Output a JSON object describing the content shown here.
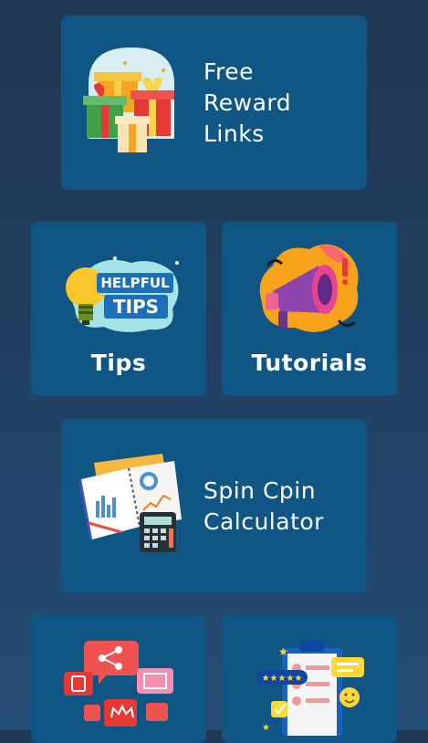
{
  "cards": {
    "free_reward": {
      "line1": "Free",
      "line2": "Reward",
      "line3": "Links",
      "icon": "gift-boxes-icon"
    },
    "tips": {
      "label": "Tips",
      "badge_line1": "HELPFUL",
      "badge_line2": "TIPS",
      "icon": "lightbulb-tips-icon"
    },
    "tutorials": {
      "label": "Tutorials",
      "icon": "megaphone-icon"
    },
    "spin_calculator": {
      "line1": "Spin Cpin",
      "line2": "Calculator",
      "icon": "notebook-calculator-icon"
    },
    "social": {
      "icon": "social-share-icon"
    },
    "reviews": {
      "icon": "reviews-clipboard-icon"
    }
  },
  "colors": {
    "background_top": "#1f3853",
    "background_bottom": "#244d75",
    "card": "#0f5684",
    "text": "#ffffff"
  }
}
